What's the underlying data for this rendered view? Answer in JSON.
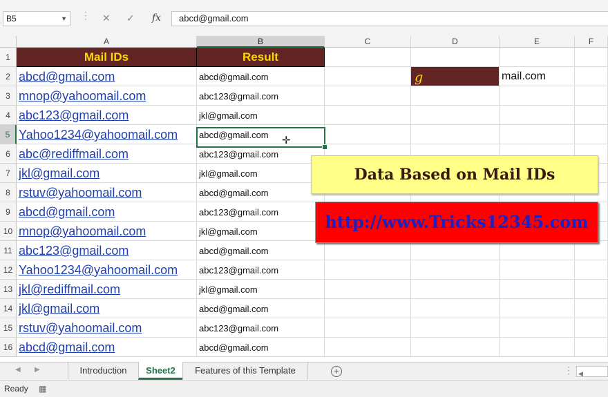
{
  "formula_bar": {
    "name_box": "B5",
    "cancel_icon": "✕",
    "enter_icon": "✓",
    "fx_label": "fx",
    "formula": "abcd@gmail.com"
  },
  "columns": [
    "A",
    "B",
    "C",
    "D",
    "E",
    "F"
  ],
  "rows": [
    "1",
    "2",
    "3",
    "4",
    "5",
    "6",
    "7",
    "8",
    "9",
    "10",
    "11",
    "12",
    "13",
    "14",
    "15",
    "16"
  ],
  "headers": {
    "mail_ids": "Mail IDs",
    "result": "Result"
  },
  "mail_ids": [
    "abcd@gmail.com",
    "mnop@yahoomail.com",
    "abc123@gmail.com",
    "Yahoo1234@yahoomail.com",
    "abc@rediffmail.com",
    "jkl@gmail.com",
    "rstuv@yahoomail.com",
    "abcd@gmail.com",
    "mnop@yahoomail.com",
    "abc123@gmail.com",
    "Yahoo1234@yahoomail.com",
    "jkl@rediffmail.com",
    "jkl@gmail.com",
    "rstuv@yahoomail.com",
    "abcd@gmail.com"
  ],
  "results": [
    "abcd@gmail.com",
    "abc123@gmail.com",
    "jkl@gmail.com",
    "abcd@gmail.com",
    "abc123@gmail.com",
    "jkl@gmail.com",
    "abcd@gmail.com",
    "abc123@gmail.com",
    "jkl@gmail.com",
    "abcd@gmail.com",
    "abc123@gmail.com",
    "jkl@gmail.com",
    "abcd@gmail.com",
    "abc123@gmail.com",
    "abcd@gmail.com"
  ],
  "d2_value": "g",
  "e2_value": "mail.com",
  "banner_title": "Data Based on Mail IDs",
  "banner_url": "http://www.Tricks12345.com",
  "tabs": [
    "Introduction",
    "Sheet2",
    "Features of this Template"
  ],
  "active_tab": "Sheet2",
  "status": "Ready",
  "colors": {
    "header_fill": "#632523",
    "header_text": "#ffd700",
    "link": "#1f3fb0",
    "accent": "#217346",
    "banner_fill": "#ffff88",
    "url_fill": "#ff0000"
  }
}
